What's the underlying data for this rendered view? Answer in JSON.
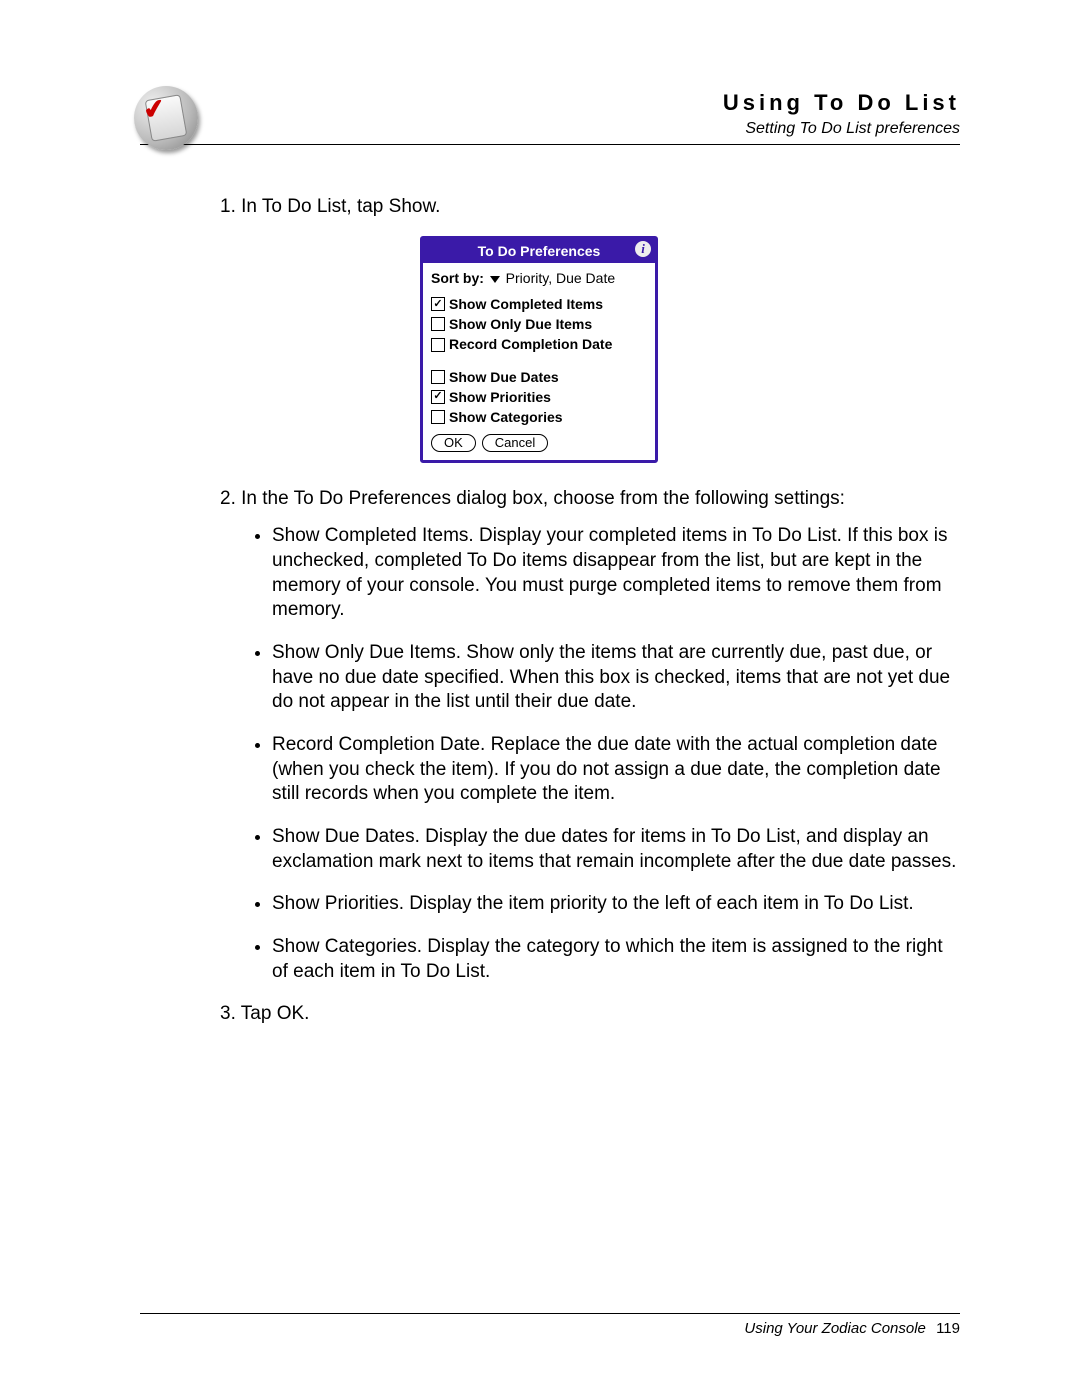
{
  "header": {
    "title": "Using To Do List",
    "subtitle": "Setting To Do List preferences",
    "icon_name": "todo-clipboard-icon"
  },
  "steps": {
    "n1": "1.",
    "s1": "In To Do List, tap Show.",
    "n2": "2.",
    "s2_intro": "In the To Do Preferences dialog box, choose from the following settings:",
    "n3": "3.",
    "s3": "Tap OK."
  },
  "bullets": [
    "Show Completed Items. Display your completed items in To Do List. If this box is unchecked, completed To Do items disappear from the list, but are kept in the memory of your console. You must purge completed items to remove them from memory.",
    "Show Only Due Items. Show only the items that are currently due, past due, or have no due date specified. When this box is checked, items that are not yet due do not appear in the list until their due date.",
    "Record Completion Date. Replace the due date with the actual completion date (when you check the item). If you do not assign a due date, the completion date still records when you complete the item.",
    "Show Due Dates. Display the due dates for items in To Do List, and display an exclamation mark next to items that remain incomplete after the due date passes.",
    "Show Priorities. Display the item priority to the left of each item in To Do List.",
    "Show Categories. Display the category to which the item is assigned to the right of each item in To Do List."
  ],
  "dialog": {
    "title": "To Do Preferences",
    "sort_label": "Sort by:",
    "sort_value": "Priority, Due Date",
    "group1": [
      {
        "label": "Show Completed Items",
        "checked": true
      },
      {
        "label": "Show Only Due Items",
        "checked": false
      },
      {
        "label": "Record Completion Date",
        "checked": false
      }
    ],
    "group2": [
      {
        "label": "Show Due Dates",
        "checked": false
      },
      {
        "label": "Show Priorities",
        "checked": true
      },
      {
        "label": "Show Categories",
        "checked": false
      }
    ],
    "ok": "OK",
    "cancel": "Cancel"
  },
  "footer": {
    "text": "Using Your Zodiac Console",
    "page": "119"
  }
}
